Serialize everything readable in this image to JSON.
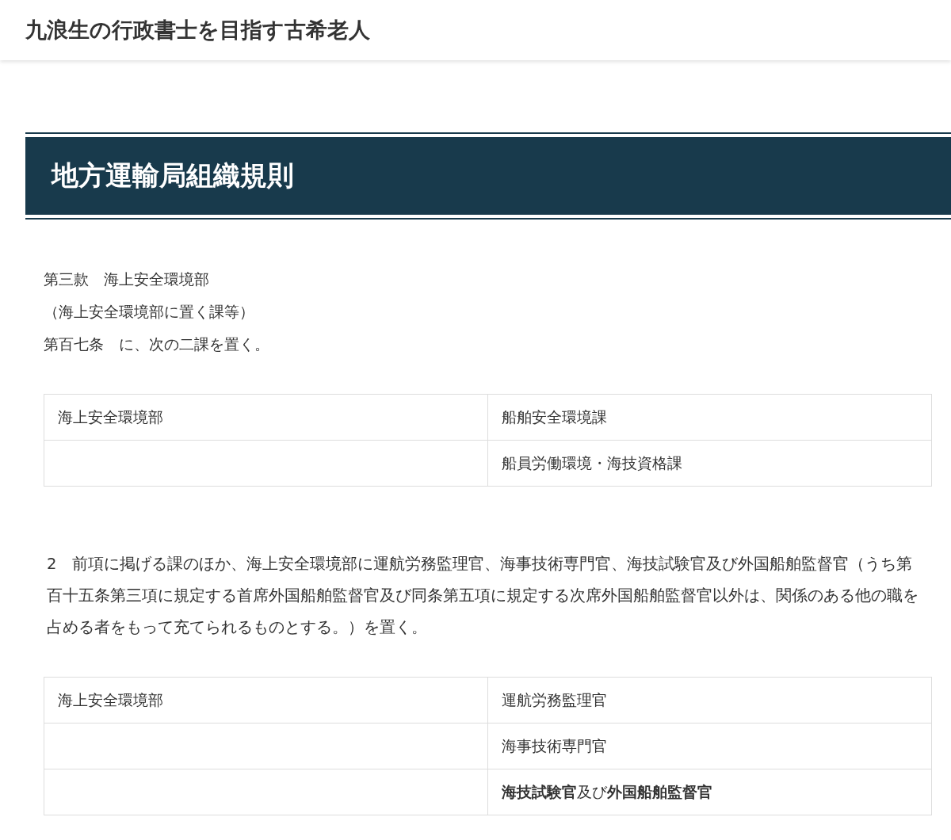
{
  "site_title": "九浪生の行政書士を目指す古希老人",
  "article_heading": "地方運輸局組織規則",
  "intro_lines": [
    "第三款　海上安全環境部",
    "（海上安全環境部に置く課等）",
    "第百七条　に、次の二課を置く。"
  ],
  "table_1": {
    "rows": [
      {
        "cells": [
          "海上安全環境部",
          "船舶安全環境課"
        ]
      },
      {
        "cells": [
          "",
          "船員労働環境・海技資格課"
        ]
      }
    ]
  },
  "paragraph": "2　前項に掲げる課のほか、海上安全環境部に運航労務監理官、海事技術専門官、海技試験官及び外国船舶監督官（うち第百十五条第三項に規定する首席外国船舶監督官及び同条第五項に規定する次席外国船舶監督官以外は、関係のある他の職を占める者をもって充てられるものとする。）を置く。",
  "table_2": {
    "rows": [
      {
        "cells": [
          "海上安全環境部",
          "運航労務監理官"
        ]
      },
      {
        "cells": [
          "",
          "海事技術専門官"
        ]
      },
      {
        "cells": [
          "",
          "**海技試験官**及び**外国船舶監督官**"
        ]
      }
    ]
  }
}
